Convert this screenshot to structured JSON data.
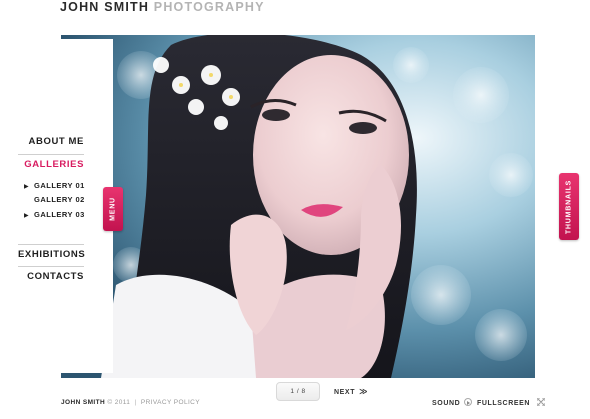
{
  "header": {
    "name": "JOHN SMITH",
    "subtitle": "PHOTOGRAPHY"
  },
  "menu": {
    "items": [
      {
        "label": "ABOUT ME"
      },
      {
        "label": "GALLERIES",
        "active": true
      },
      {
        "label": "EXHIBITIONS"
      },
      {
        "label": "CONTACTS"
      }
    ],
    "sub_items": [
      {
        "arrow": "▶",
        "label": "GALLERY 01"
      },
      {
        "arrow": "",
        "label": "GALLERY 02"
      },
      {
        "arrow": "▶",
        "label": "GALLERY 03"
      }
    ],
    "tab_label": "MENU"
  },
  "thumbnails_tab": {
    "label": "THUMBNAILS"
  },
  "footer": {
    "copyright_name": "JOHN SMITH",
    "copyright_rest": "© 2011",
    "separator": "|",
    "privacy": "PRIVACY POLICY"
  },
  "controls": {
    "pager": "1 / 8",
    "next": "NEXT",
    "next_icon": "≫",
    "sound": "SOUND",
    "fullscreen": "FULLSCREEN"
  },
  "colors": {
    "accent": "#d81b60",
    "tab_gradient_top": "#e8346f",
    "tab_gradient_bottom": "#c2134f"
  },
  "icons": [
    "play-arrow-icon",
    "double-chevron-right-icon",
    "sound-icon",
    "fullscreen-icon"
  ]
}
